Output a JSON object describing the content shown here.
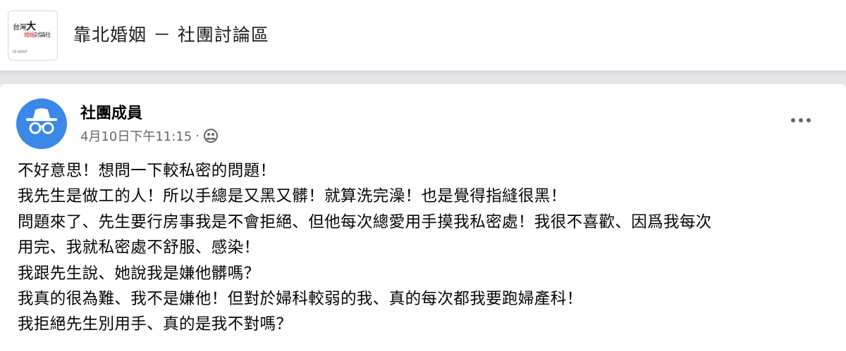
{
  "group": {
    "title": "靠北婚姻 － 社團討論區",
    "logo": {
      "line1_prefix": "台灣",
      "line1_big": "大",
      "line2_red": "婚姻",
      "line2_rest": "討論社",
      "line3": "FB GROUP"
    }
  },
  "post": {
    "author": "社團成員",
    "timestamp": "4月10日下午11:15",
    "separator": "·",
    "privacy_icon": "group-members-icon",
    "more_icon": "ellipsis-icon",
    "avatar_icon": "anonymous-member-icon",
    "lines": [
      "不好意思！想問一下較私密的問題！",
      "我先生是做工的人！所以手總是又黑又髒！就算洗完澡！也是覺得指縫很黑！",
      "問題來了、先生要行房事我是不會拒絕、但他每次總愛用手摸我私密處！我很不喜歡、因爲我每次",
      "用完、我就私密處不舒服、感染！",
      "我跟先生說、她說我是嫌他髒嗎？",
      "我真的很為難、我不是嫌他！但對於婦科較弱的我、真的每次都我要跑婦產科！",
      "我拒絕先生別用手、真的是我不對嗎？"
    ]
  },
  "colors": {
    "page_background": "#e4e6e9",
    "avatar_blue": "#3b88e8",
    "meta_gray": "#65676b",
    "logo_red": "#c9302c"
  }
}
